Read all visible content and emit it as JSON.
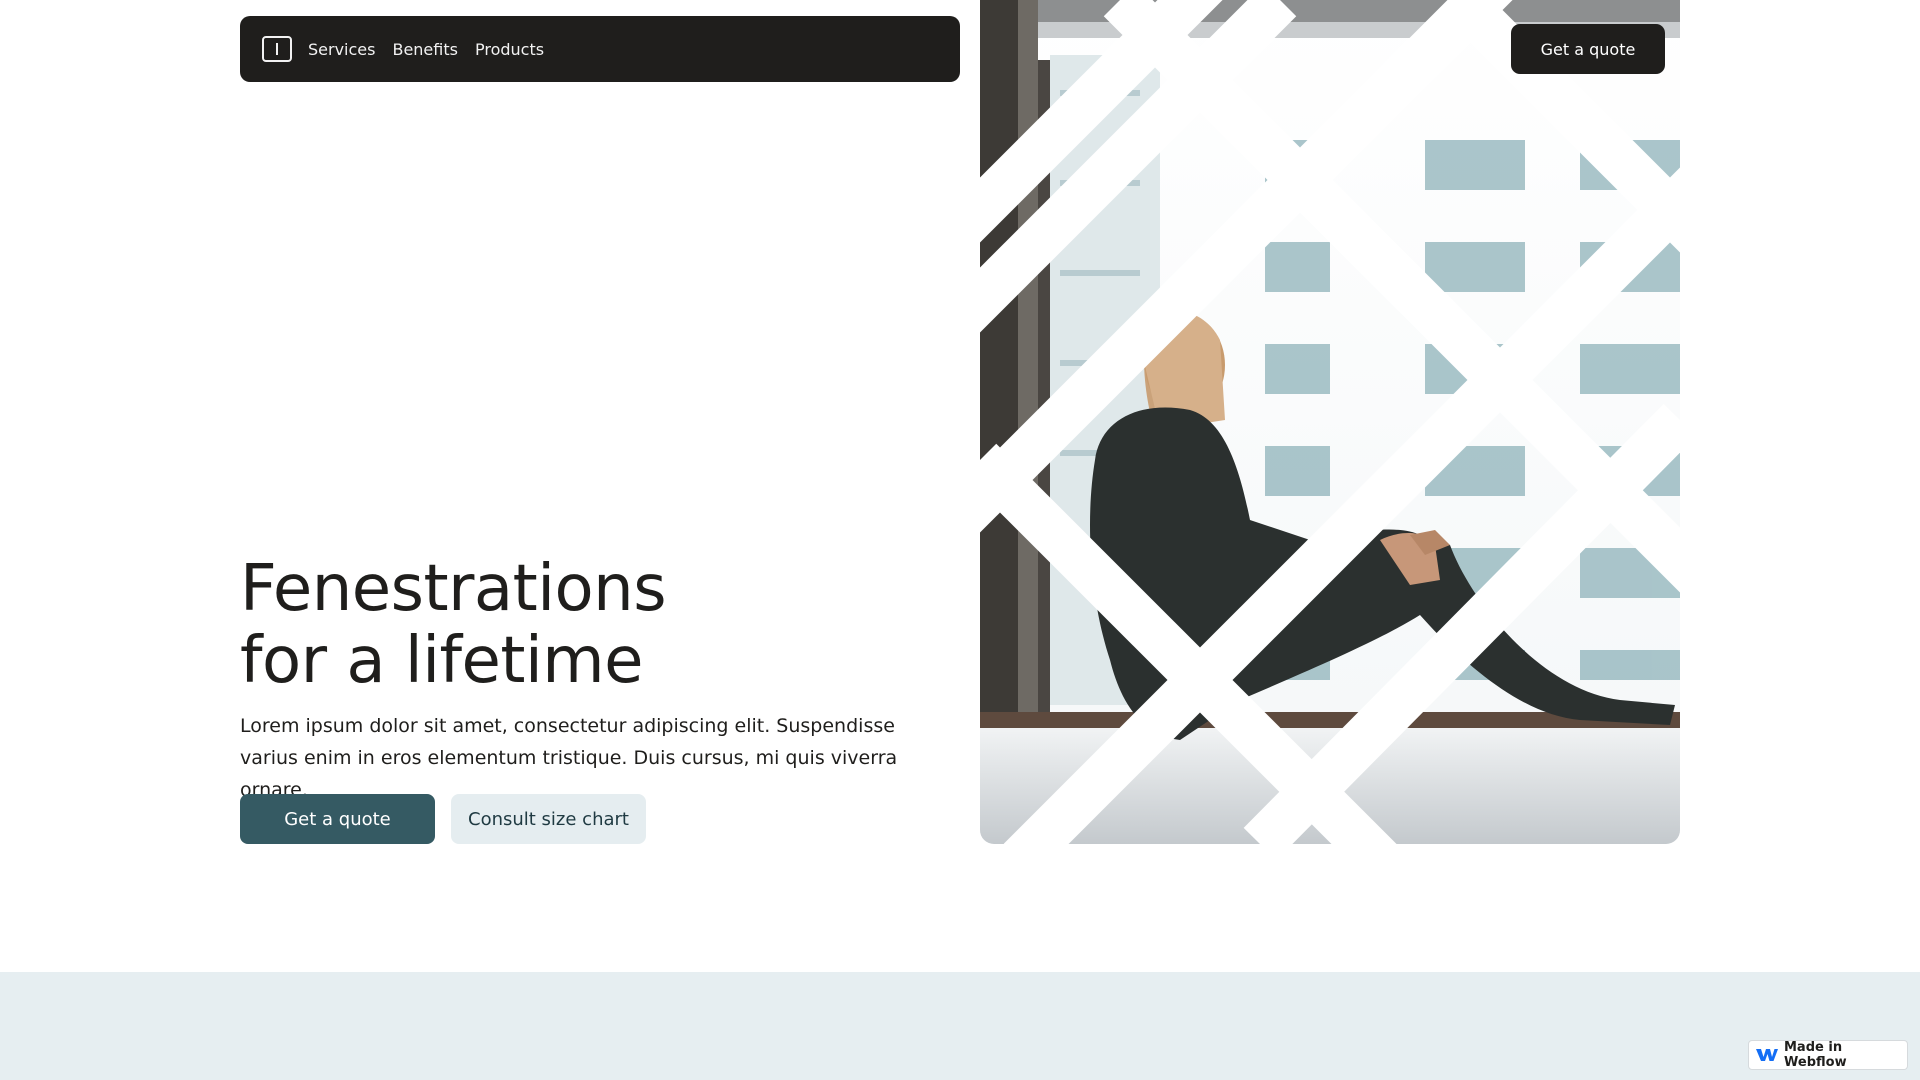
{
  "nav": {
    "links": [
      "Services",
      "Benefits",
      "Products"
    ],
    "cta_label": "Get a quote"
  },
  "hero": {
    "title_line1": "Fenestrations",
    "title_line2": "for a lifetime",
    "description": "Lorem ipsum dolor sit amet, consectetur adipiscing elit. Suspendisse varius enim in eros elementum tristique. Duis cursus, mi quis viverra ornare.",
    "primary_button": "Get a quote",
    "secondary_button": "Consult size chart",
    "image_icon": "woman-sitting-by-window-photo"
  },
  "badge": {
    "label": "Made in Webflow",
    "icon": "webflow-logo-icon"
  },
  "colors": {
    "dark": "#1f1e1c",
    "primary": "#355a63",
    "secondary_bg": "#e5edf0",
    "section_bg": "#e6eef1"
  }
}
